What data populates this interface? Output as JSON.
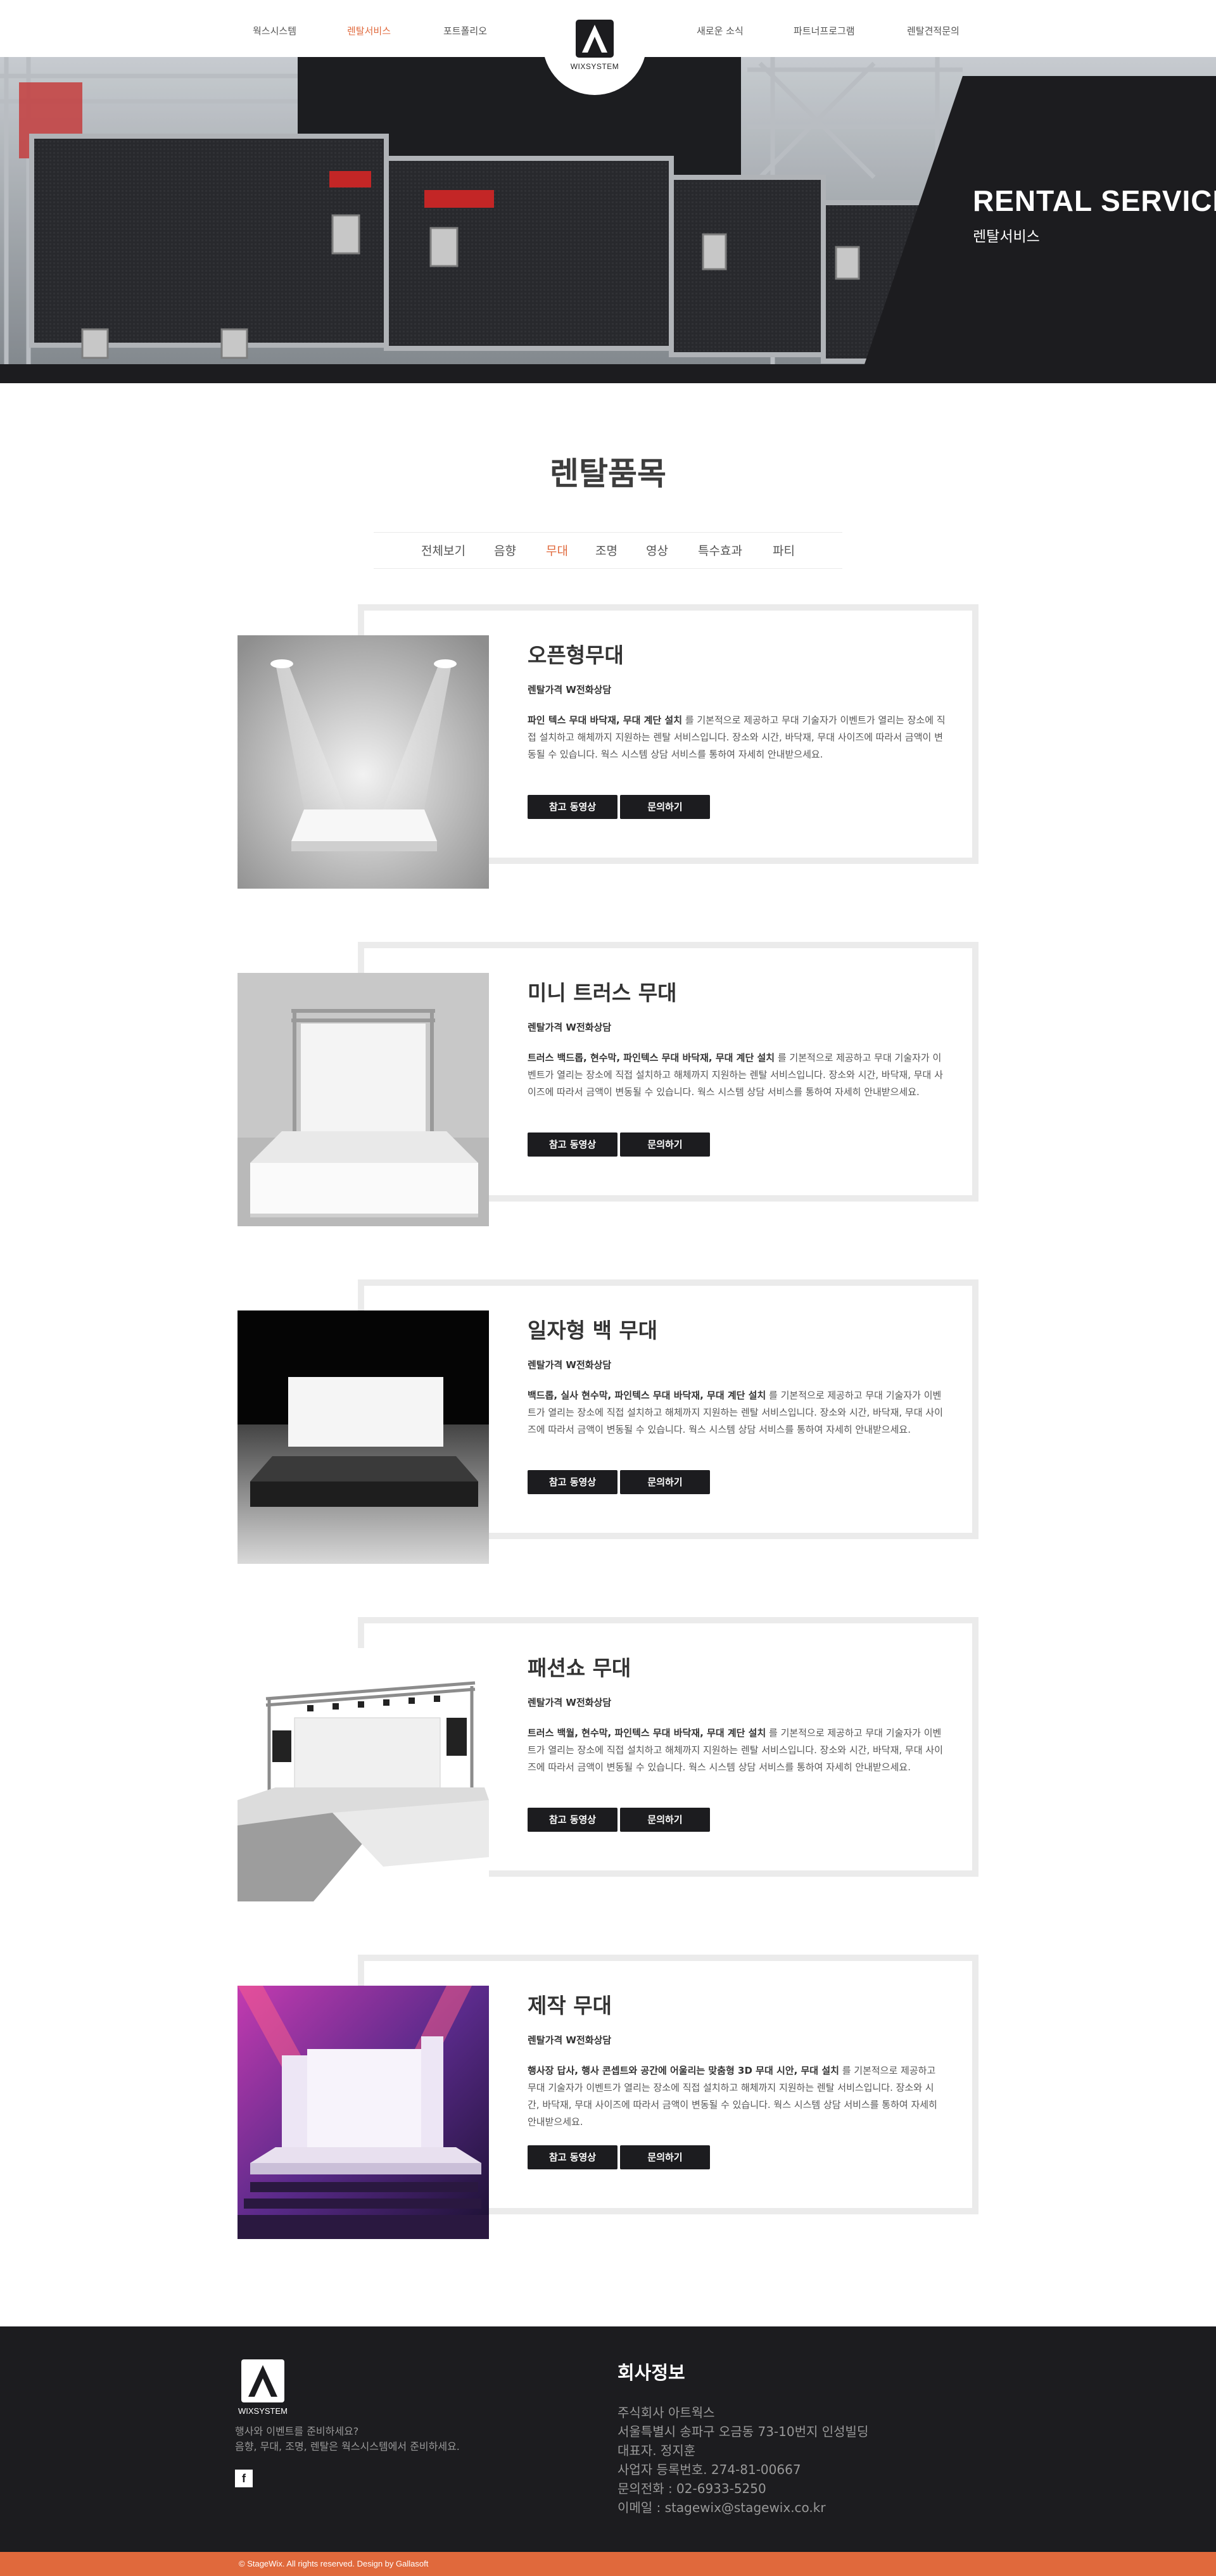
{
  "nav": {
    "left": [
      "웍스시스템",
      "렌탈서비스",
      "포트폴리오"
    ],
    "right": [
      "새로운 소식",
      "파트너프로그램",
      "렌탈견적문의"
    ],
    "logo_text": "WIXSYSTEM"
  },
  "hero": {
    "title": "RENTAL SERVICE",
    "subtitle": "렌탈서비스"
  },
  "section_title": "렌탈품목",
  "filters": [
    "전체보기",
    "음향",
    "무대",
    "조명",
    "영상",
    "특수효과",
    "파티"
  ],
  "active_filter": "무대",
  "products": [
    {
      "title": "오픈형무대",
      "price": "렌탈가격 W전화상담",
      "desc_bold": "파인 텍스 무대 바닥재, 무대 계단 설치",
      "desc_rest": " 를 기본적으로 제공하고 무대 기술자가 이벤트가 열리는 장소에 직접 설치하고 해체까지 지원하는 렌탈 서비스입니다. 장소와 시간, 바닥재, 무대 사이즈에 따라서 금액이 변동될 수 있습니다. 웍스 시스템 상담 서비스를 통하여 자세히 안내받으세요.",
      "btn_video": "참고 동영상",
      "btn_inquiry": "문의하기"
    },
    {
      "title": "미니 트러스 무대",
      "price": "렌탈가격 W전화상담",
      "desc_bold": "트러스 백드롭, 현수막, 파인텍스 무대 바닥재, 무대 계단 설치",
      "desc_rest": " 를 기본적으로 제공하고 무대 기술자가 이벤트가 열리는 장소에 직접 설치하고 해체까지 지원하는 렌탈 서비스입니다. 장소와 시간, 바닥재, 무대 사이즈에 따라서 금액이 변동될 수 있습니다. 웍스 시스템 상담 서비스를 통하여 자세히 안내받으세요.",
      "btn_video": "참고 동영상",
      "btn_inquiry": "문의하기"
    },
    {
      "title": "일자형 백 무대",
      "price": "렌탈가격 W전화상담",
      "desc_bold": "백드롭, 실사 현수막, 파인텍스 무대 바닥재, 무대 계단 설치",
      "desc_rest": " 를 기본적으로 제공하고 무대 기술자가 이벤트가 열리는 장소에 직접 설치하고 해체까지 지원하는 렌탈 서비스입니다. 장소와 시간, 바닥재, 무대 사이즈에 따라서 금액이 변동될 수 있습니다. 웍스 시스템 상담 서비스를 통하여 자세히 안내받으세요.",
      "btn_video": "참고 동영상",
      "btn_inquiry": "문의하기"
    },
    {
      "title": "패션쇼 무대",
      "price": "렌탈가격 W전화상담",
      "desc_bold": "트러스 백월, 현수막, 파인텍스 무대 바닥재, 무대 계단 설치",
      "desc_rest": " 를 기본적으로 제공하고 무대 기술자가 이벤트가 열리는 장소에 직접 설치하고 해체까지 지원하는 렌탈 서비스입니다. 장소와 시간, 바닥재, 무대 사이즈에 따라서 금액이 변동될 수 있습니다. 웍스 시스템 상담 서비스를 통하여 자세히 안내받으세요.",
      "btn_video": "참고 동영상",
      "btn_inquiry": "문의하기"
    },
    {
      "title": "제작 무대",
      "price": "렌탈가격 W전화상담",
      "desc_bold": "행사장 답사, 행사 콘셉트와 공간에 어울리는 맞춤형 3D 무대 시안, 무대 설치",
      "desc_rest": " 를 기본적으로 제공하고 무대 기술자가 이벤트가 열리는 장소에 직접 설치하고 해체까지 지원하는 렌탈 서비스입니다. 장소와 시간, 바닥재, 무대 사이즈에 따라서 금액이 변동될 수 있습니다. 웍스 시스템 상담 서비스를 통하여 자세히 안내받으세요.",
      "btn_video": "참고 동영상",
      "btn_inquiry": "문의하기"
    }
  ],
  "footer": {
    "logo_text": "WIXSYSTEM",
    "tagline1": "행사와 이벤트를 준비하세요?",
    "tagline2": "음향, 무대, 조명, 렌탈은 웍스시스템에서 준비하세요.",
    "facebook": "f",
    "heading": "회사정보",
    "lines": [
      "주식회사 아트웍스",
      "서울특별시 송파구 오금동 73-10번지 인성빌딩",
      "대표자. 정지훈",
      "사업자 등록번호. 274-81-00667",
      "문의전화 : 02-6933-5250",
      "이메일 : stagewix@stagewix.co.kr"
    ],
    "copyright": "© StageWix. All rights reserved. Design by Gallasoft"
  },
  "colors": {
    "accent": "#e0693c",
    "dark": "#1c1c1f",
    "frame": "#ebebeb"
  }
}
